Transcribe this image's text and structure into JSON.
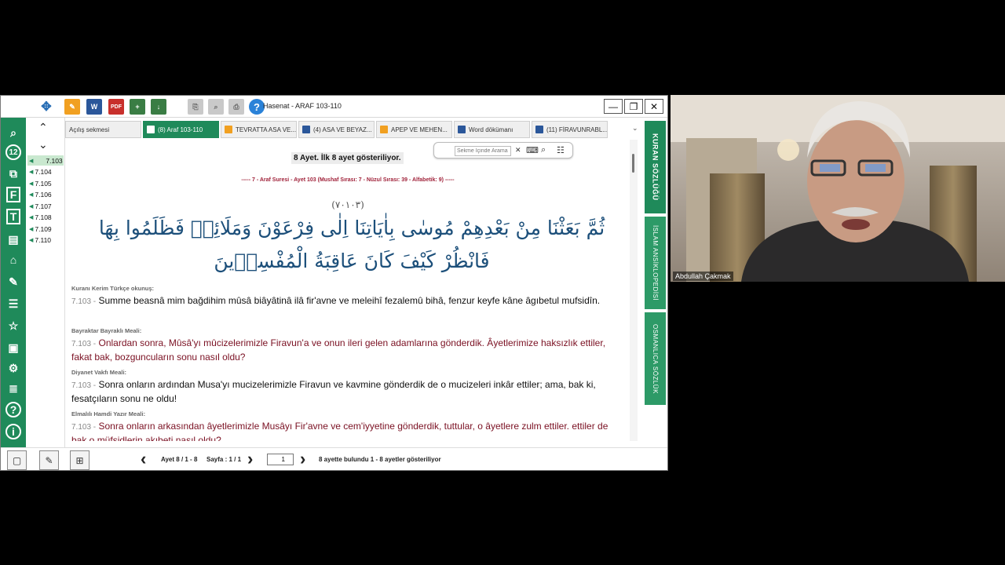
{
  "window": {
    "title": "Hasenat - ARAF 103-110",
    "minimize": "—",
    "restore": "❐",
    "close": "✕"
  },
  "verse_nav": {
    "items": [
      "7.103",
      "7.104",
      "7.105",
      "7.106",
      "7.107",
      "7.108",
      "7.109",
      "7.110"
    ],
    "active_index": 0
  },
  "tabs": [
    {
      "label": "Açılış sekmesi",
      "active": false
    },
    {
      "label": "(8) Araf 103-110",
      "active": true
    },
    {
      "label": "TEVRATTA ASA VE...",
      "active": false
    },
    {
      "label": "(4) ASA VE BEYAZ...",
      "active": false
    },
    {
      "label": "APEP VE MEHEN...",
      "active": false
    },
    {
      "label": "Word dökümanı",
      "active": false
    },
    {
      "label": "(11) FİRAVUNRABL...",
      "active": false
    }
  ],
  "search": {
    "placeholder": "Sekme İçinde Arama",
    "clear": "✕"
  },
  "content": {
    "show_info": "8 Ayet. İlk 8 ayet gösteriliyor.",
    "ayah_header": "-----   7 - Araf Suresi - Ayet 103 (Mushaf Sırası: 7 - Nüzul Sırası: 39 - Alfabetik: 9)   -----",
    "ayah_number": "(٧٠١٠٣)",
    "arabic": "ثُمَّ بَعَثْنَا مِنْ بَعْدِهِمْ مُوسٰى بِاٰيَاتِنَا اِلٰى فِرْعَوْنَ وَمَلَائِه۪ فَظَلَمُوا بِهَا فَانْظُرْ كَيْفَ كَانَ عَاقِبَةُ الْمُفْسِد۪ينَ",
    "sections": [
      {
        "label": "Kuranı Kerim Türkçe okunuş:",
        "verse": "7.103 -",
        "text": "Summe beasnâ mim bağdihim mûsâ biâyâtinâ ilâ fir'avne ve meleihî fezalemû bihâ, fenzur keyfe kâne âgıbetul mufsidîn.",
        "color": "#111111"
      },
      {
        "label": "Bayraktar Bayraklı Meali:",
        "verse": "7.103 -",
        "text": "Onlardan sonra, Mûsâ'yı mûcizelerimizle Firavun'a ve onun ileri gelen adamlarına gönderdik. Âyetlerimize haksızlık ettiler, fakat bak, bozguncuların sonu nasıl oldu?",
        "color": "#7a1022"
      },
      {
        "label": "Diyanet Vakfı Meali:",
        "verse": "7.103 -",
        "text": "Sonra onların ardından Musa'yı mucizelerimizle Firavun ve kavmine gönderdik de o mucizeleri inkâr ettiler; ama, bak ki, fesatçıların sonu ne oldu!",
        "color": "#111111"
      },
      {
        "label": "Elmalılı Hamdi Yazır Meali:",
        "verse": "7.103 -",
        "text": "Sonra onların arkasından âyetlerimizle Musâyı Fir'avne ve cem'iyyetine gönderdik, tuttular, o âyetlere zulm ettiler. ettiler de bak o müfsidlerin akıbeti nasıl oldu?",
        "color": "#7a1022"
      }
    ]
  },
  "bottom": {
    "ayet": "Ayet 8 / 1 - 8",
    "sayfa": "Sayfa : 1 / 1",
    "page_value": "1",
    "found": "8 ayette bulundu 1 - 8 ayetler gösteriliyor"
  },
  "right_tools": [
    {
      "label": "KURAN SÖZLÜĞÜ"
    },
    {
      "label": "İSLAM ANSİKLOPEDİSİ"
    },
    {
      "label": "OSMANLICA SÖZLÜK"
    }
  ],
  "video": {
    "participant_name": "Abdullah Çakmak"
  },
  "colors": {
    "accent_green": "#1f8a5a",
    "arabic_blue": "#1c4f7a",
    "meal_red": "#7a1022",
    "header_red": "#a0223a"
  }
}
